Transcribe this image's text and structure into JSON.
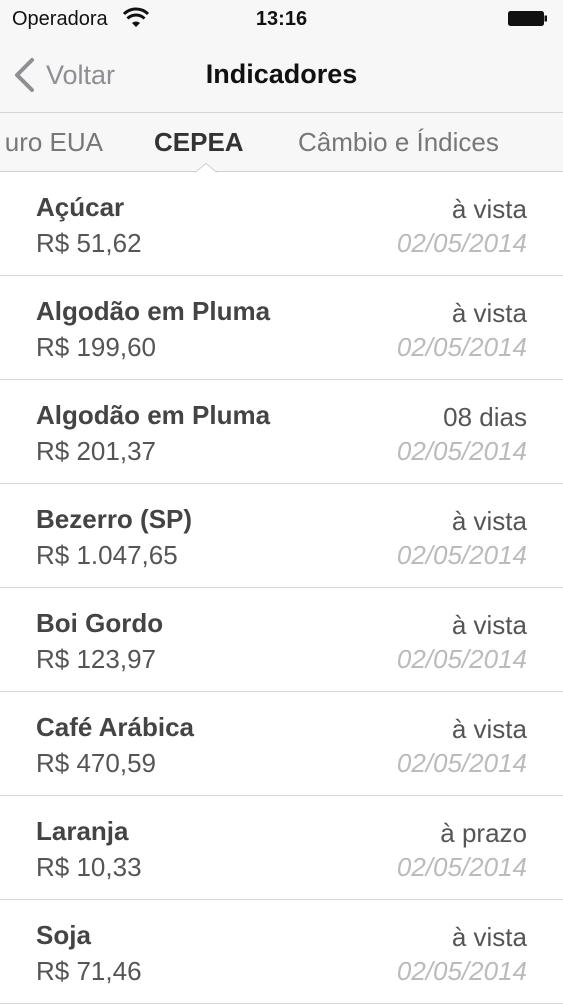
{
  "status_bar": {
    "carrier": "Operadora",
    "time": "13:16"
  },
  "nav": {
    "back_label": "Voltar",
    "title": "Indicadores"
  },
  "tabs": [
    {
      "label": "uro EUA"
    },
    {
      "label": "CEPEA",
      "selected": true
    },
    {
      "label": "Câmbio e Índices"
    }
  ],
  "items": [
    {
      "name": "Açúcar",
      "price": "R$ 51,62",
      "term": "à vista",
      "date": "02/05/2014"
    },
    {
      "name": "Algodão em Pluma",
      "price": "R$ 199,60",
      "term": "à vista",
      "date": "02/05/2014"
    },
    {
      "name": "Algodão em Pluma",
      "price": "R$ 201,37",
      "term": "08 dias",
      "date": "02/05/2014"
    },
    {
      "name": "Bezerro (SP)",
      "price": "R$ 1.047,65",
      "term": "à vista",
      "date": "02/05/2014"
    },
    {
      "name": "Boi Gordo",
      "price": "R$ 123,97",
      "term": "à vista",
      "date": "02/05/2014"
    },
    {
      "name": "Café Arábica",
      "price": "R$ 470,59",
      "term": "à vista",
      "date": "02/05/2014"
    },
    {
      "name": "Laranja",
      "price": "R$ 10,33",
      "term": "à prazo",
      "date": "02/05/2014"
    },
    {
      "name": "Soja",
      "price": "R$ 71,46",
      "term": "à vista",
      "date": "02/05/2014"
    }
  ],
  "icons": {
    "wifi": "wifi-icon",
    "battery": "battery-icon",
    "back": "chevron-left-icon"
  }
}
